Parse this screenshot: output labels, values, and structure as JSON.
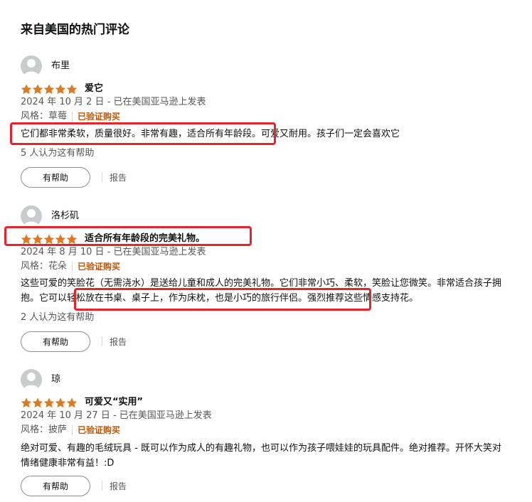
{
  "section_title": "来自美国的热门评论",
  "colors": {
    "star": "#de7921",
    "verified": "#c45500",
    "highlight": "#e3262b"
  },
  "reviews": [
    {
      "author": "布里",
      "rating": 5,
      "title": "爱它",
      "meta": "2024 年 10 月 2 日 - 已在美国亚马逊上发表",
      "format_label": "风格：草莓",
      "verified": "已验证购买",
      "body": "它们都非常柔软，质量很好。非常有趣，适合所有年龄段。可爱又耐用。孩子们一定会喜欢它",
      "helpful_count": "5 人认为这有帮助",
      "helpful_button": "有帮助",
      "report": "报告"
    },
    {
      "author": "洛杉矶",
      "rating": 5,
      "title": "适合所有年龄段的完美礼物。",
      "meta": "2024 年 8 月 10 日 - 已在美国亚马逊上发表",
      "format_label": "风格：花朵",
      "verified": "已验证购买",
      "body": "这些可爱的笑脸花（无需浇水）是送给儿童和成人的完美礼物。它们非常小巧、柔软，笑脸让您微笑。非常适合孩子拥抱。它可以轻松放在书桌、桌子上，作为床枕，也是小巧的旅行伴侣。强烈推荐这些情感支持花。",
      "helpful_count": "2 人认为这有帮助",
      "helpful_button": "有帮助",
      "report": "报告"
    },
    {
      "author": "琼",
      "rating": 5,
      "title": "可爱又“实用”",
      "meta": "2024 年 10 月 27 日 - 已在美国亚马逊上发表",
      "format_label": "风格：披萨",
      "verified": "已验证购买",
      "body": "绝对可爱、有趣的毛绒玩具 - 既可以作为成人的有趣礼物，也可以作为孩子喂娃娃的玩具配件。绝对推荐。开怀大笑对情绪健康非常有益！:D",
      "helpful_button": "有帮助",
      "report": "报告"
    }
  ]
}
